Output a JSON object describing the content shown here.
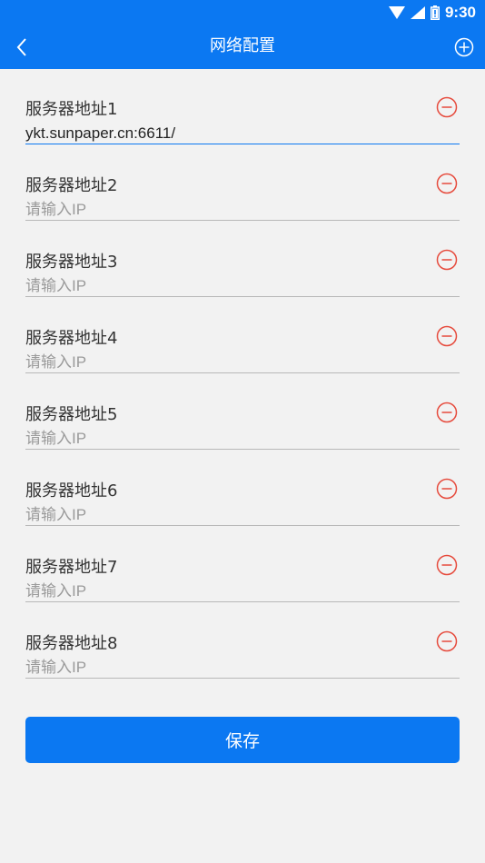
{
  "status_bar": {
    "time": "9:30",
    "icons": [
      "wifi-icon",
      "signal-icon",
      "battery-icon"
    ]
  },
  "header": {
    "title": "网络配置",
    "back_icon": "chevron-left-icon",
    "add_icon": "plus-circle-icon"
  },
  "servers": [
    {
      "label": "服务器地址1",
      "value": "ykt.sunpaper.cn:6611/",
      "placeholder": "请输入IP"
    },
    {
      "label": "服务器地址2",
      "value": "",
      "placeholder": "请输入IP"
    },
    {
      "label": "服务器地址3",
      "value": "",
      "placeholder": "请输入IP"
    },
    {
      "label": "服务器地址4",
      "value": "",
      "placeholder": "请输入IP"
    },
    {
      "label": "服务器地址5",
      "value": "",
      "placeholder": "请输入IP"
    },
    {
      "label": "服务器地址6",
      "value": "",
      "placeholder": "请输入IP"
    },
    {
      "label": "服务器地址7",
      "value": "",
      "placeholder": "请输入IP"
    },
    {
      "label": "服务器地址8",
      "value": "",
      "placeholder": "请输入IP"
    }
  ],
  "save_label": "保存",
  "colors": {
    "primary": "#0b78f2",
    "remove": "#e64a3c",
    "background": "#f2f2f2"
  }
}
